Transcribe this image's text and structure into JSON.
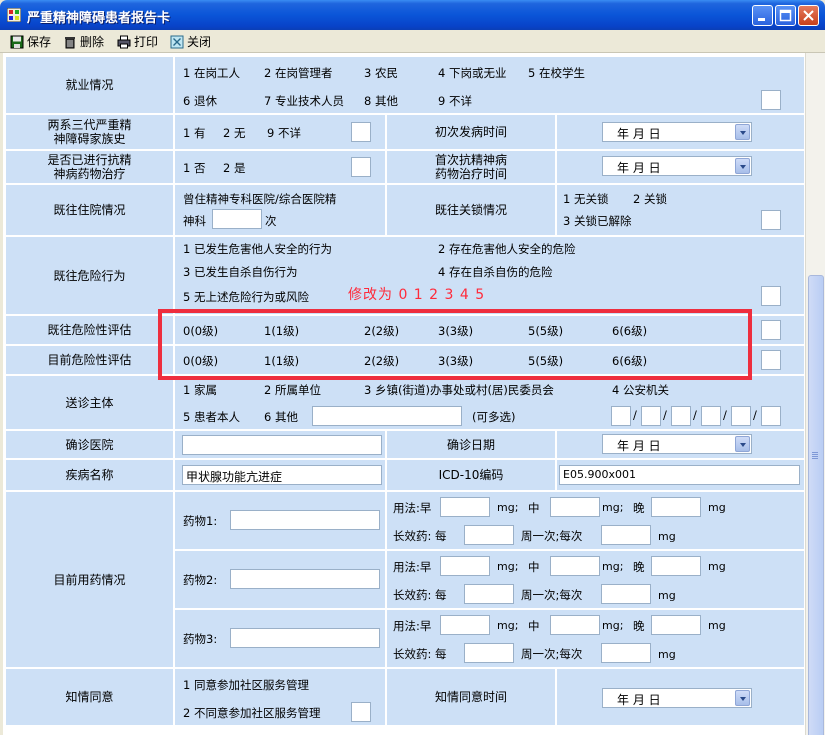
{
  "window": {
    "title": "严重精神障碍患者报告卡"
  },
  "toolbar": {
    "save": "保存",
    "delete": "删除",
    "print": "打印",
    "close": "关闭"
  },
  "employment": {
    "label": "就业情况",
    "options": [
      "1 在岗工人",
      "2 在岗管理者",
      "3 农民",
      "4 下岗或无业",
      "5 在校学生",
      "6 退休",
      "7 专业技术人员",
      "8 其他",
      "9 不详"
    ]
  },
  "family_history": {
    "label_line1": "两系三代严重精",
    "label_line2": "神障碍家族史",
    "options": [
      "1 有",
      "2 无",
      "9 不详"
    ],
    "onset_label": "初次发病时间",
    "date": "年    月    日"
  },
  "medication": {
    "label_line1": "是否已进行抗精",
    "label_line2": "神病药物治疗",
    "options": [
      "1 否",
      "2 是"
    ],
    "first_label_line1": "首次抗精神病",
    "first_label_line2": "药物治疗时间",
    "date": "年    月    日"
  },
  "hospital": {
    "label": "既往住院情况",
    "text1": "曾住精神专科医院/综合医院精",
    "text2": "神科",
    "text3": "次",
    "lock_label": "既往关锁情况",
    "lock_options": [
      "1 无关锁",
      "2 关锁",
      "3 关锁已解除"
    ]
  },
  "danger": {
    "label": "既往危险行为",
    "options": [
      "1 已发生危害他人安全的行为",
      "2 存在危害他人安全的危险",
      "3 已发生自杀自伤行为",
      "4 存在自杀自伤的危险",
      "5 无上述危险行为或风险"
    ],
    "annotation": "修改为 0 1 2 3 4 5"
  },
  "risk_past": {
    "label": "既往危险性评估",
    "options": [
      "0(0级)",
      "1(1级)",
      "2(2级)",
      "3(3级)",
      "5(5级)",
      "6(6级)"
    ]
  },
  "risk_now": {
    "label": "目前危险性评估",
    "options": [
      "0(0级)",
      "1(1级)",
      "2(2级)",
      "3(3级)",
      "5(5级)",
      "6(6级)"
    ]
  },
  "sender": {
    "label": "送诊主体",
    "options": [
      "1 家属",
      "2 所属单位",
      "3 乡镇(街道)办事处或村(居)民委员会",
      "4 公安机关",
      "5 患者本人",
      "6 其他"
    ],
    "multi": "(可多选)"
  },
  "diagnosis": {
    "hospital_label": "确诊医院",
    "date_label": "确诊日期",
    "date": "年    月    日"
  },
  "disease": {
    "label": "疾病名称",
    "value": "甲状腺功能亢进症",
    "icd_label": "ICD-10编码",
    "icd_value": "E05.900x001"
  },
  "drugs": {
    "label": "目前用药情况",
    "items": [
      {
        "name": "药物1:"
      },
      {
        "name": "药物2:"
      },
      {
        "name": "药物3:"
      }
    ],
    "usage": "用法:早",
    "mg": "mg;",
    "mid": "中",
    "evening": "晚",
    "mg_end": "mg",
    "long_acting": "长效药: 每",
    "weekly": "周一次;每次",
    "mg_unit": "mg"
  },
  "consent": {
    "label": "知情同意",
    "options": [
      "1 同意参加社区服务管理",
      "2 不同意参加社区服务管理"
    ],
    "time_label": "知情同意时间",
    "date": "年    月    日"
  }
}
